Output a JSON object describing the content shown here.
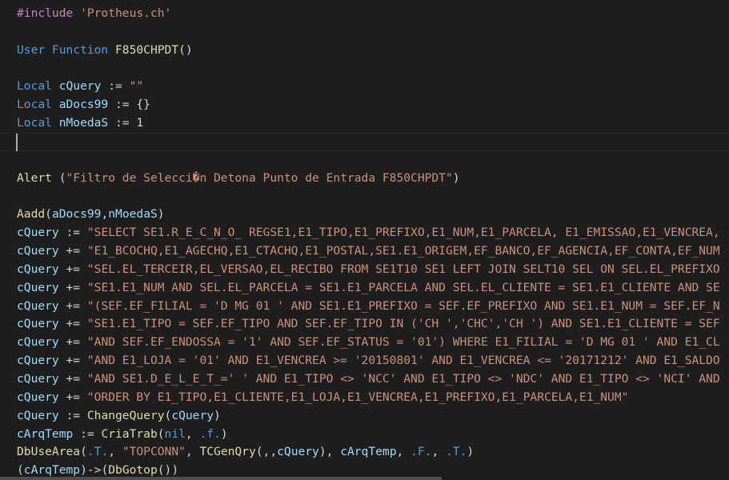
{
  "editor": {
    "lines": [
      [
        {
          "t": "#include ",
          "c": "c-pre"
        },
        {
          "t": "'Protheus.ch'",
          "c": "c-str"
        }
      ],
      [],
      [
        {
          "t": "User Function ",
          "c": "c-kw"
        },
        {
          "t": "F850CHPDT",
          "c": "c-fn"
        },
        {
          "t": "()",
          "c": "c-plain"
        }
      ],
      [],
      [
        {
          "t": "Local ",
          "c": "c-kw"
        },
        {
          "t": "cQuery",
          "c": "c-var"
        },
        {
          "t": " := ",
          "c": "c-plain"
        },
        {
          "t": "\"\"",
          "c": "c-str"
        }
      ],
      [
        {
          "t": "Local ",
          "c": "c-kw"
        },
        {
          "t": "aDocs99",
          "c": "c-var"
        },
        {
          "t": " := {}",
          "c": "c-plain"
        }
      ],
      [
        {
          "t": "Local ",
          "c": "c-kw"
        },
        {
          "t": "nMoedaS",
          "c": "c-var"
        },
        {
          "t": " := ",
          "c": "c-plain"
        },
        {
          "t": "1",
          "c": "c-plain"
        }
      ],
      [],
      [],
      [
        {
          "t": "Alert ",
          "c": "c-fn"
        },
        {
          "t": "(",
          "c": "c-plain"
        },
        {
          "t": "\"Filtro de Selecci�n Detona Punto de Entrada F850CHPDT\"",
          "c": "c-str"
        },
        {
          "t": ")",
          "c": "c-plain"
        }
      ],
      [],
      [
        {
          "t": "Aadd",
          "c": "c-fn"
        },
        {
          "t": "(",
          "c": "c-plain"
        },
        {
          "t": "aDocs99",
          "c": "c-var"
        },
        {
          "t": ",",
          "c": "c-plain"
        },
        {
          "t": "nMoedaS",
          "c": "c-var"
        },
        {
          "t": ")",
          "c": "c-plain"
        }
      ],
      [
        {
          "t": "cQuery",
          "c": "c-var"
        },
        {
          "t": " := ",
          "c": "c-plain"
        },
        {
          "t": "\"SELECT SE1.R_E_C_N_O_ REGSE1,E1_TIPO,E1_PREFIXO,E1_NUM,E1_PARCELA, E1_EMISSAO,E1_VENCREA,",
          "c": "c-str"
        }
      ],
      [
        {
          "t": "cQuery",
          "c": "c-var"
        },
        {
          "t": " += ",
          "c": "c-plain"
        },
        {
          "t": "\"E1_BCOCHQ,E1_AGECHQ,E1_CTACHQ,E1_POSTAL,SE1.E1_ORIGEM,EF_BANCO,EF_AGENCIA,EF_CONTA,EF_NUM",
          "c": "c-str"
        }
      ],
      [
        {
          "t": "cQuery",
          "c": "c-var"
        },
        {
          "t": " += ",
          "c": "c-plain"
        },
        {
          "t": "\"SEL.EL_TERCEIR,EL_VERSAO,EL_RECIBO FROM SE1T10 SE1 LEFT JOIN SELT10 SEL ON SEL.EL_PREFIXO",
          "c": "c-str"
        }
      ],
      [
        {
          "t": "cQuery",
          "c": "c-var"
        },
        {
          "t": " += ",
          "c": "c-plain"
        },
        {
          "t": "\"SE1.E1_NUM AND SEL.EL_PARCELA = SE1.E1_PARCELA AND SEL.EL_CLIENTE = SE1.E1_CLIENTE AND SE",
          "c": "c-str"
        }
      ],
      [
        {
          "t": "cQuery",
          "c": "c-var"
        },
        {
          "t": " += ",
          "c": "c-plain"
        },
        {
          "t": "\"(SEF.EF_FILIAL = 'D MG 01 ' AND SE1.E1_PREFIXO = SEF.EF_PREFIXO AND SE1.E1_NUM = SEF.EF_N",
          "c": "c-str"
        }
      ],
      [
        {
          "t": "cQuery",
          "c": "c-var"
        },
        {
          "t": " += ",
          "c": "c-plain"
        },
        {
          "t": "\"SE1.E1_TIPO = SEF.EF_TIPO AND SEF.EF_TIPO IN ('CH ','CHC','CH ') AND SE1.E1_CLIENTE = SEF",
          "c": "c-str"
        }
      ],
      [
        {
          "t": "cQuery",
          "c": "c-var"
        },
        {
          "t": " += ",
          "c": "c-plain"
        },
        {
          "t": "\"AND SEF.EF_ENDOSSA = '1' AND SEF.EF_STATUS = '01') WHERE E1_FILIAL = 'D MG 01 ' AND E1_CL",
          "c": "c-str"
        }
      ],
      [
        {
          "t": "cQuery",
          "c": "c-var"
        },
        {
          "t": " += ",
          "c": "c-plain"
        },
        {
          "t": "\"AND E1_LOJA = '01' AND E1_VENCREA >= '20150801' AND E1_VENCREA <= '20171212' AND E1_SALDO",
          "c": "c-str"
        }
      ],
      [
        {
          "t": "cQuery",
          "c": "c-var"
        },
        {
          "t": " += ",
          "c": "c-plain"
        },
        {
          "t": "\"AND SE1.D_E_L_E_T_=' ' AND E1_TIPO <> 'NCC' AND E1_TIPO <> 'NDC' AND E1_TIPO <> 'NCI' AND",
          "c": "c-str"
        }
      ],
      [
        {
          "t": "cQuery",
          "c": "c-var"
        },
        {
          "t": " += ",
          "c": "c-plain"
        },
        {
          "t": "\"ORDER BY E1_TIPO,E1_CLIENTE,E1_LOJA,E1_VENCREA,E1_PREFIXO,E1_PARCELA,E1_NUM\"",
          "c": "c-str"
        }
      ],
      [
        {
          "t": "cQuery",
          "c": "c-var"
        },
        {
          "t": " := ",
          "c": "c-plain"
        },
        {
          "t": "ChangeQuery",
          "c": "c-fn"
        },
        {
          "t": "(",
          "c": "c-plain"
        },
        {
          "t": "cQuery",
          "c": "c-var"
        },
        {
          "t": ")",
          "c": "c-plain"
        }
      ],
      [
        {
          "t": "cArqTemp",
          "c": "c-var"
        },
        {
          "t": " := ",
          "c": "c-plain"
        },
        {
          "t": "CriaTrab",
          "c": "c-fn"
        },
        {
          "t": "(",
          "c": "c-plain"
        },
        {
          "t": "nil",
          "c": "c-kw"
        },
        {
          "t": ", ",
          "c": "c-plain"
        },
        {
          "t": ".f.",
          "c": "c-kw"
        },
        {
          "t": ")",
          "c": "c-plain"
        }
      ],
      [
        {
          "t": "DbUseArea",
          "c": "c-fn"
        },
        {
          "t": "(",
          "c": "c-plain"
        },
        {
          "t": ".T.",
          "c": "c-kw"
        },
        {
          "t": ", ",
          "c": "c-plain"
        },
        {
          "t": "\"TOPCONN\"",
          "c": "c-str"
        },
        {
          "t": ", ",
          "c": "c-plain"
        },
        {
          "t": "TCGenQry",
          "c": "c-fn"
        },
        {
          "t": "(,,",
          "c": "c-plain"
        },
        {
          "t": "cQuery",
          "c": "c-var"
        },
        {
          "t": "), ",
          "c": "c-plain"
        },
        {
          "t": "cArqTemp",
          "c": "c-var"
        },
        {
          "t": ", ",
          "c": "c-plain"
        },
        {
          "t": ".F.",
          "c": "c-kw"
        },
        {
          "t": ", ",
          "c": "c-plain"
        },
        {
          "t": ".T.",
          "c": "c-kw"
        },
        {
          "t": ")",
          "c": "c-plain"
        }
      ],
      [
        {
          "t": "(",
          "c": "c-plain"
        },
        {
          "t": "cArqTemp",
          "c": "c-var"
        },
        {
          "t": ")->(",
          "c": "c-plain"
        },
        {
          "t": "DbGotop",
          "c": "c-fn"
        },
        {
          "t": "())",
          "c": "c-plain"
        }
      ]
    ]
  }
}
